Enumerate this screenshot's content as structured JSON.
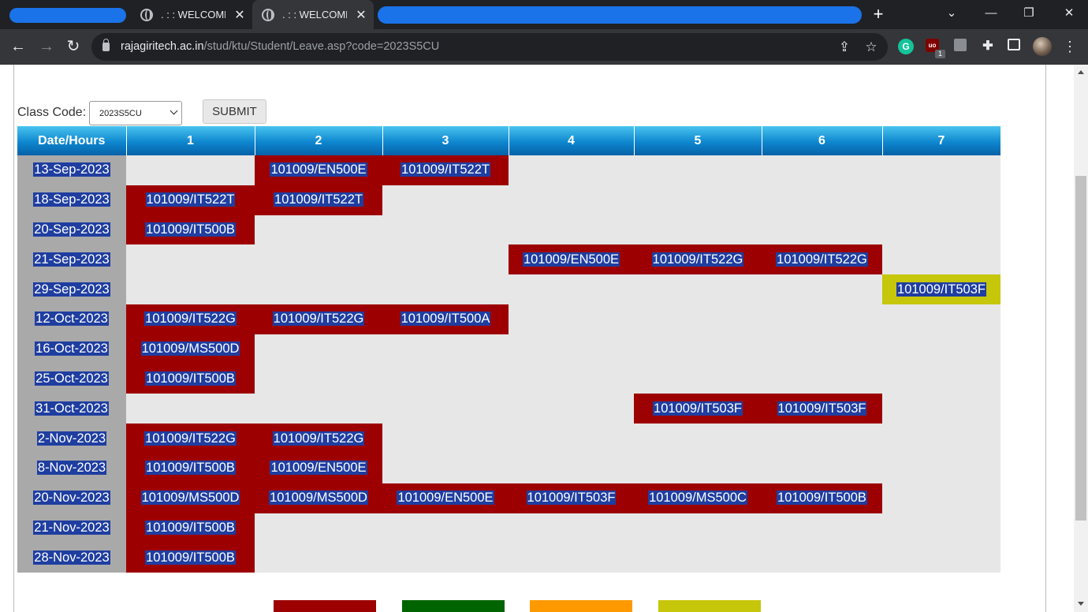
{
  "browser": {
    "tabs": [
      {
        "title": ". : : WELCOME",
        "active": false
      },
      {
        "title": ". : : WELCOME",
        "active": true
      }
    ],
    "url_host": "rajagiritech.ac.in",
    "url_path": "/stud/ktu/Student/Leave.asp?code=2023S5CU",
    "extension_badge": "1"
  },
  "form": {
    "class_code_label": "Class Code:",
    "class_code_value": "2023S5CU",
    "submit_label": "SUBMIT"
  },
  "table": {
    "headers": [
      "Date/Hours",
      "1",
      "2",
      "3",
      "4",
      "5",
      "6",
      "7"
    ],
    "rows": [
      {
        "date": "13-Sep-2023",
        "cells": [
          "",
          "101009/EN500E",
          "101009/IT522T",
          "",
          "",
          "",
          ""
        ],
        "status": [
          "",
          "red",
          "red",
          "",
          "",
          "",
          ""
        ]
      },
      {
        "date": "18-Sep-2023",
        "cells": [
          "101009/IT522T",
          "101009/IT522T",
          "",
          "",
          "",
          "",
          ""
        ],
        "status": [
          "red",
          "red",
          "",
          "",
          "",
          "",
          ""
        ]
      },
      {
        "date": "20-Sep-2023",
        "cells": [
          "101009/IT500B",
          "",
          "",
          "",
          "",
          "",
          ""
        ],
        "status": [
          "red",
          "",
          "",
          "",
          "",
          "",
          ""
        ]
      },
      {
        "date": "21-Sep-2023",
        "cells": [
          "",
          "",
          "",
          "101009/EN500E",
          "101009/IT522G",
          "101009/IT522G",
          ""
        ],
        "status": [
          "",
          "",
          "",
          "red",
          "red",
          "red",
          ""
        ]
      },
      {
        "date": "29-Sep-2023",
        "cells": [
          "",
          "",
          "",
          "",
          "",
          "",
          "101009/IT503F"
        ],
        "status": [
          "",
          "",
          "",
          "",
          "",
          "",
          "yel"
        ]
      },
      {
        "date": "12-Oct-2023",
        "cells": [
          "101009/IT522G",
          "101009/IT522G",
          "101009/IT500A",
          "",
          "",
          "",
          ""
        ],
        "status": [
          "red",
          "red",
          "red",
          "",
          "",
          "",
          ""
        ]
      },
      {
        "date": "16-Oct-2023",
        "cells": [
          "101009/MS500D",
          "",
          "",
          "",
          "",
          "",
          ""
        ],
        "status": [
          "red",
          "",
          "",
          "",
          "",
          "",
          ""
        ]
      },
      {
        "date": "25-Oct-2023",
        "cells": [
          "101009/IT500B",
          "",
          "",
          "",
          "",
          "",
          ""
        ],
        "status": [
          "red",
          "",
          "",
          "",
          "",
          "",
          ""
        ]
      },
      {
        "date": "31-Oct-2023",
        "cells": [
          "",
          "",
          "",
          "",
          "101009/IT503F",
          "101009/IT503F",
          ""
        ],
        "status": [
          "",
          "",
          "",
          "",
          "red",
          "red",
          ""
        ]
      },
      {
        "date": "2-Nov-2023",
        "cells": [
          "101009/IT522G",
          "101009/IT522G",
          "",
          "",
          "",
          "",
          ""
        ],
        "status": [
          "red",
          "red",
          "",
          "",
          "",
          "",
          ""
        ]
      },
      {
        "date": "8-Nov-2023",
        "cells": [
          "101009/IT500B",
          "101009/EN500E",
          "",
          "",
          "",
          "",
          ""
        ],
        "status": [
          "red",
          "red",
          "",
          "",
          "",
          "",
          ""
        ]
      },
      {
        "date": "20-Nov-2023",
        "cells": [
          "101009/MS500D",
          "101009/MS500D",
          "101009/EN500E",
          "101009/IT503F",
          "101009/MS500C",
          "101009/IT500B",
          ""
        ],
        "status": [
          "red",
          "red",
          "red",
          "red",
          "red",
          "red",
          ""
        ]
      },
      {
        "date": "21-Nov-2023",
        "cells": [
          "101009/IT500B",
          "",
          "",
          "",
          "",
          "",
          ""
        ],
        "status": [
          "red",
          "",
          "",
          "",
          "",
          "",
          ""
        ]
      },
      {
        "date": "28-Nov-2023",
        "cells": [
          "101009/IT500B",
          "",
          "",
          "",
          "",
          "",
          ""
        ],
        "status": [
          "red",
          "",
          "",
          "",
          "",
          "",
          ""
        ]
      }
    ]
  },
  "legend_colors": [
    "#9d0000",
    "#006400",
    "#ff9900",
    "#c6c60a"
  ],
  "colors": {
    "absent": "#9d0000",
    "other": "#c6c60a",
    "header": "#0e86cf",
    "text_highlight": "#1f3ea0"
  }
}
